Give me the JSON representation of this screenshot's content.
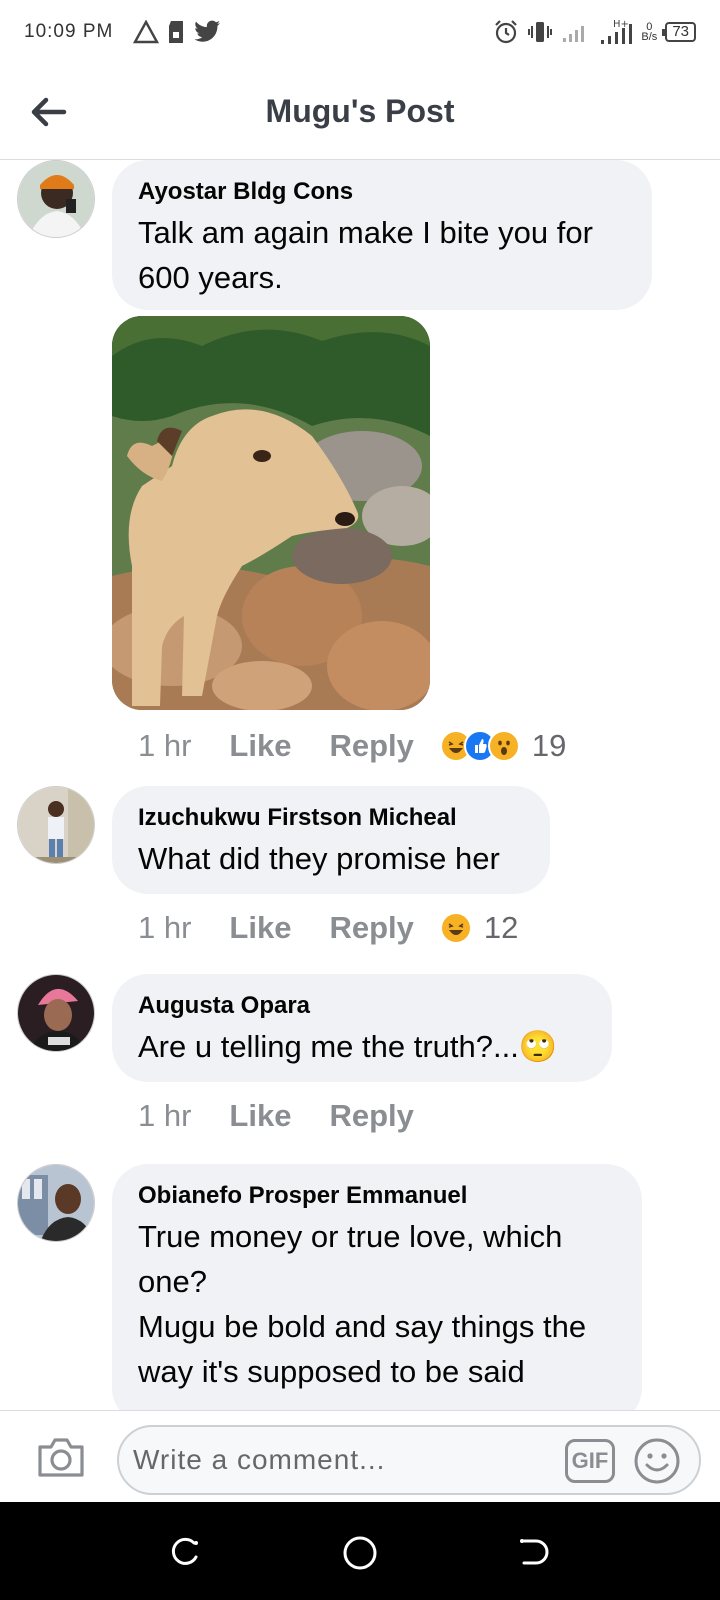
{
  "status_bar": {
    "time": "10:09 PM",
    "network_speed_value": "0",
    "network_speed_unit": "B/s",
    "battery": "73",
    "icons": [
      "warning-icon",
      "sd-card-icon",
      "twitter-icon",
      "alarm-icon",
      "vibrate-icon",
      "signal-icon",
      "signal-h-plus-icon"
    ]
  },
  "header": {
    "title": "Mugu's Post",
    "back_icon": "arrow-left-icon"
  },
  "comments": [
    {
      "author": "Ayostar Bldg Cons",
      "text": "Talk am again make I bite you for 600 years.",
      "time": "1 hr",
      "like": "Like",
      "reply": "Reply",
      "reactions": [
        "haha",
        "like",
        "wow"
      ],
      "reaction_count": "19",
      "has_photo": true
    },
    {
      "author": "Izuchukwu Firstson Micheal",
      "text": "What did they promise her",
      "time": "1 hr",
      "like": "Like",
      "reply": "Reply",
      "reactions": [
        "haha"
      ],
      "reaction_count": "12"
    },
    {
      "author": "Augusta Opara",
      "text": "Are u telling me the truth?...",
      "emoji": "🙄",
      "time": "1 hr",
      "like": "Like",
      "reply": "Reply"
    },
    {
      "author": "Obianefo Prosper Emmanuel",
      "text_line1": "True money or true love, which one?",
      "text_line2": "Mugu be bold and say things the way it's supposed to be said"
    }
  ],
  "composer": {
    "placeholder": "Write a comment...",
    "gif_label": "GIF"
  },
  "colors": {
    "bubble": "#f0f2f5",
    "meta_text": "#8a8d91",
    "like_blue": "#1877f2",
    "haha_yellow": "#f7b125"
  }
}
